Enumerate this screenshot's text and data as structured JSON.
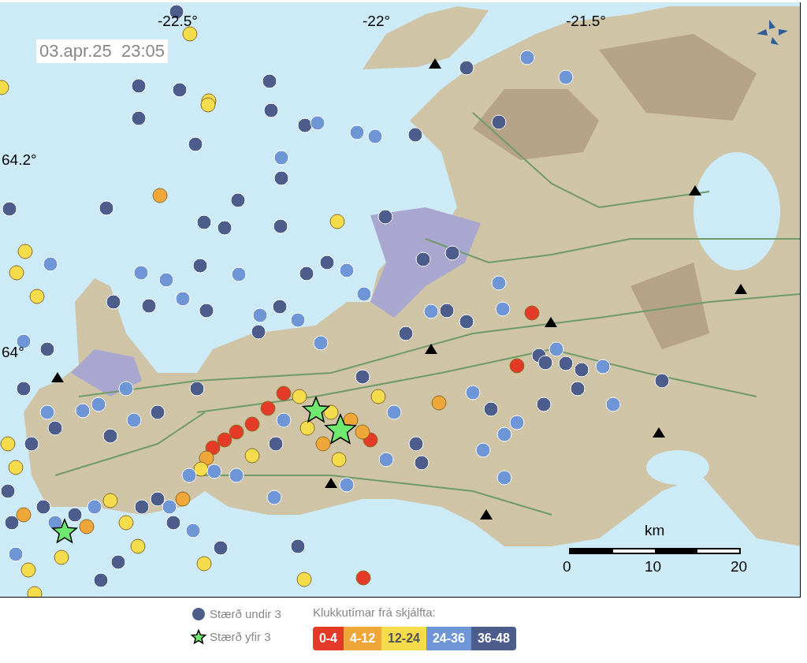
{
  "map": {
    "timestamp": "03.apr.25  23:05",
    "longitude_labels": [
      "-22.5°",
      "-22°",
      "-21.5°"
    ],
    "latitude_labels": [
      "64.2°",
      "64°"
    ],
    "scale_bar": {
      "unit": "km",
      "ticks": [
        "0",
        "10",
        "20"
      ]
    }
  },
  "legend": {
    "symbols": [
      {
        "kind": "circle",
        "label": "Stærð undir 3"
      },
      {
        "kind": "star",
        "label": "Stærð yfir 3"
      }
    ],
    "age_title": "Klukkutímar frá skjálfta:",
    "age_bins": [
      {
        "label": "0-4",
        "color": "#e43a28"
      },
      {
        "label": "4-12",
        "color": "#f0a73a"
      },
      {
        "label": "12-24",
        "color": "#f5dc4c"
      },
      {
        "label": "24-36",
        "color": "#6e95d5"
      },
      {
        "label": "36-48",
        "color": "#4c5d8c"
      }
    ]
  }
}
